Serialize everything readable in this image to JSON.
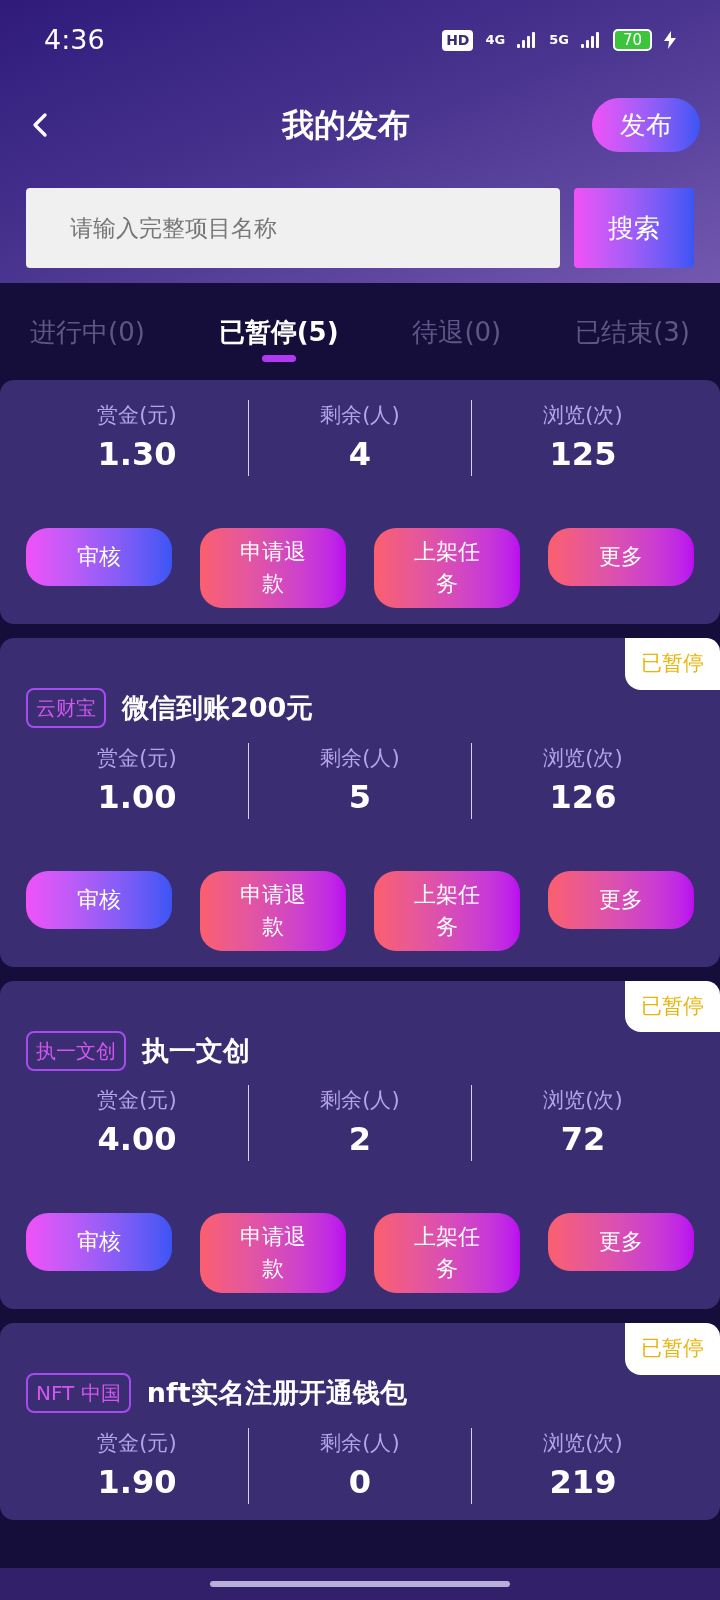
{
  "status_bar": {
    "time": "4:36",
    "hd": "HD",
    "net1": "4G",
    "net2": "5G",
    "battery": "70"
  },
  "header": {
    "title": "我的发布",
    "publish": "发布"
  },
  "search": {
    "placeholder": "请输入完整项目名称",
    "button": "搜索"
  },
  "tabs": [
    {
      "label": "进行中(0)",
      "selected": false
    },
    {
      "label": "已暂停(5)",
      "selected": true
    },
    {
      "label": "待退(0)",
      "selected": false
    },
    {
      "label": "已结束(3)",
      "selected": false
    }
  ],
  "cards": [
    {
      "stats": [
        {
          "label": "赏金(元)",
          "value": "1.30"
        },
        {
          "label": "剩余(人)",
          "value": "4"
        },
        {
          "label": "浏览(次)",
          "value": "125"
        }
      ],
      "buttons": [
        {
          "label": "审核",
          "kind": "primary"
        },
        {
          "label": "申请退款",
          "kind": "secondary"
        },
        {
          "label": "上架任务",
          "kind": "secondary"
        },
        {
          "label": "更多",
          "kind": "secondary"
        }
      ]
    },
    {
      "badge": "已暂停",
      "tag": "云财宝",
      "title": "微信到账200元",
      "stats": [
        {
          "label": "赏金(元)",
          "value": "1.00"
        },
        {
          "label": "剩余(人)",
          "value": "5"
        },
        {
          "label": "浏览(次)",
          "value": "126"
        }
      ],
      "buttons": [
        {
          "label": "审核",
          "kind": "primary"
        },
        {
          "label": "申请退款",
          "kind": "secondary"
        },
        {
          "label": "上架任务",
          "kind": "secondary"
        },
        {
          "label": "更多",
          "kind": "secondary"
        }
      ]
    },
    {
      "badge": "已暂停",
      "tag": "执一文创",
      "title": "执一文创",
      "stats": [
        {
          "label": "赏金(元)",
          "value": "4.00"
        },
        {
          "label": "剩余(人)",
          "value": "2"
        },
        {
          "label": "浏览(次)",
          "value": "72"
        }
      ],
      "buttons": [
        {
          "label": "审核",
          "kind": "primary"
        },
        {
          "label": "申请退款",
          "kind": "secondary"
        },
        {
          "label": "上架任务",
          "kind": "secondary"
        },
        {
          "label": "更多",
          "kind": "secondary"
        }
      ]
    },
    {
      "badge": "已暂停",
      "tag": "NFT 中国",
      "title": "nft实名注册开通钱包",
      "stats": [
        {
          "label": "赏金(元)",
          "value": "1.90"
        },
        {
          "label": "剩余(人)",
          "value": "0"
        },
        {
          "label": "浏览(次)",
          "value": "219"
        }
      ]
    }
  ]
}
